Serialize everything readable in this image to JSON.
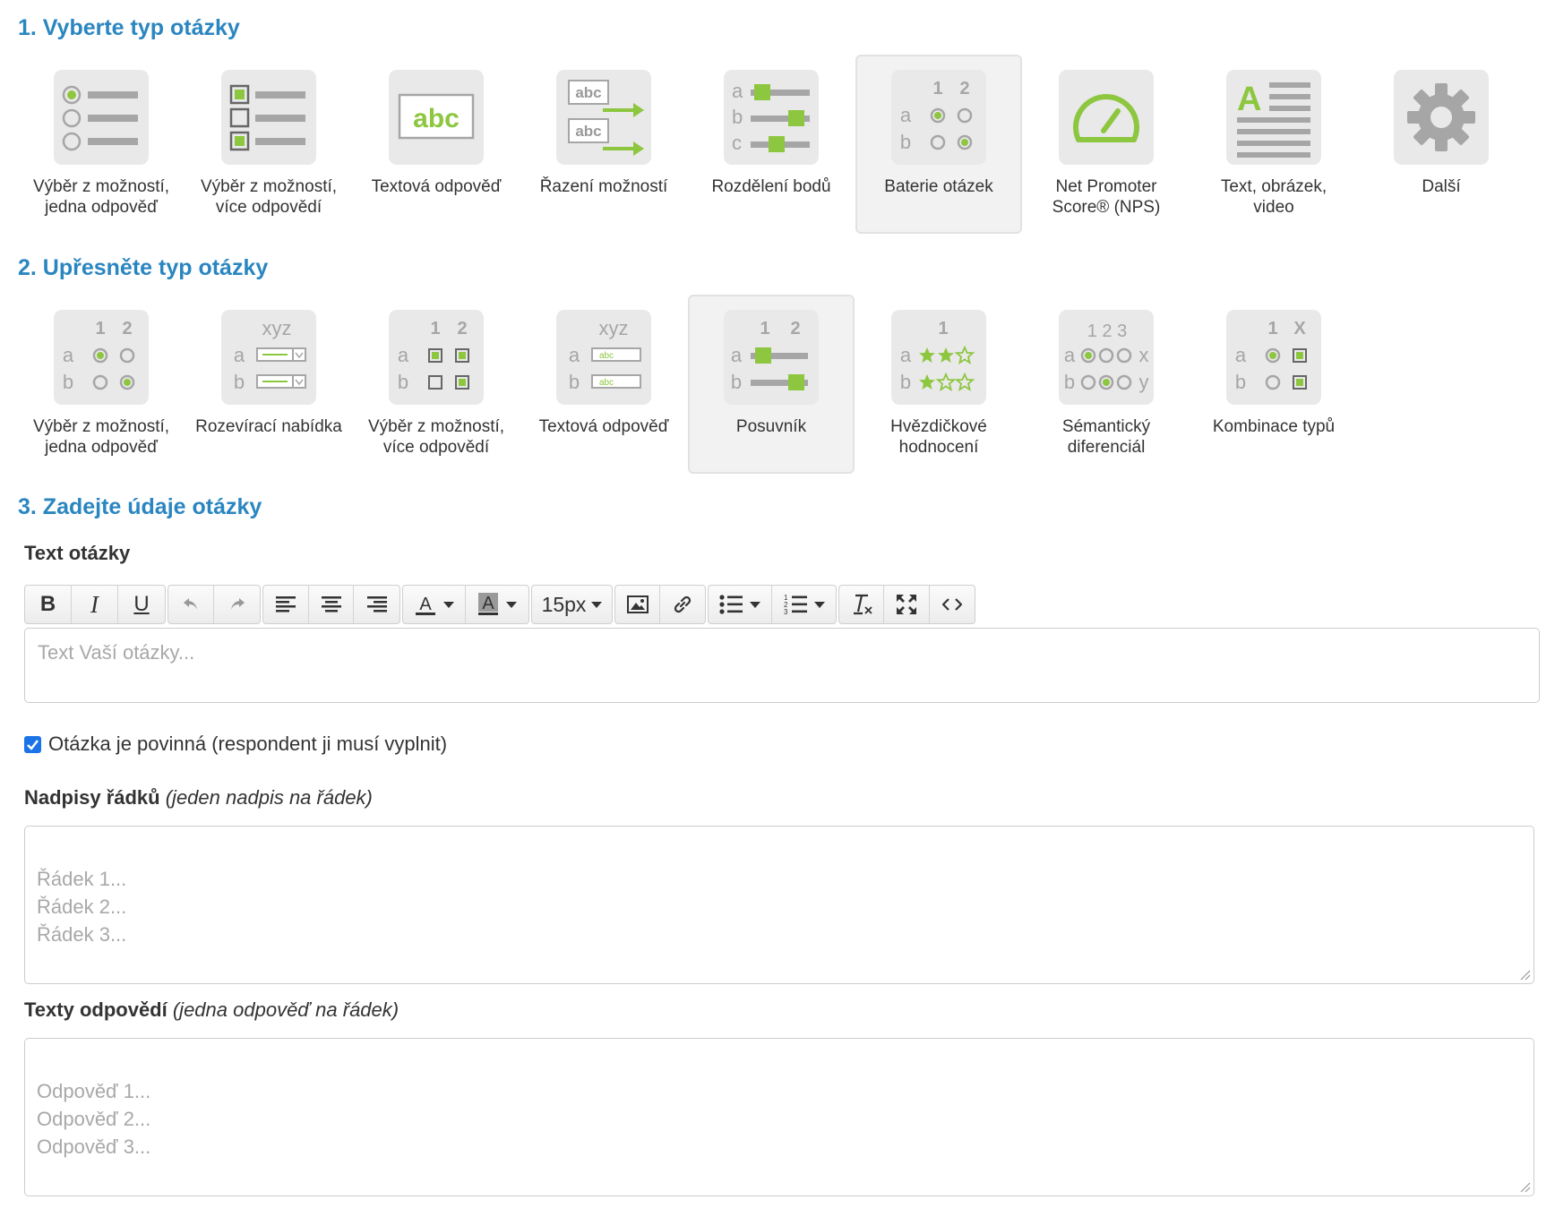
{
  "step1": {
    "title": "1. Vyberte typ otázky",
    "types": [
      {
        "label": "Výběr z možností,\njedna odpověď",
        "icon": "single-choice-icon"
      },
      {
        "label": "Výběr z možností,\nvíce odpovědí",
        "icon": "multiple-choice-icon"
      },
      {
        "label": "Textová odpověď",
        "icon": "text-answer-icon"
      },
      {
        "label": "Řazení možností",
        "icon": "ranking-icon"
      },
      {
        "label": "Rozdělení bodů",
        "icon": "points-allocation-icon"
      },
      {
        "label": "Baterie otázek",
        "icon": "question-battery-icon",
        "selected": true
      },
      {
        "label": "Net Promoter\nScore® (NPS)",
        "icon": "nps-gauge-icon"
      },
      {
        "label": "Text, obrázek,\nvideo",
        "icon": "text-image-video-icon"
      },
      {
        "label": "Další",
        "icon": "gear-icon"
      }
    ]
  },
  "step2": {
    "title": "2. Upřesněte typ otázky",
    "types": [
      {
        "label": "Výběr z možností,\njedna odpověď",
        "icon": "matrix-single-choice-icon"
      },
      {
        "label": "Rozevírací nabídka",
        "icon": "matrix-dropdown-icon"
      },
      {
        "label": "Výběr z možností,\nvíce odpovědí",
        "icon": "matrix-multiple-choice-icon"
      },
      {
        "label": "Textová odpověď",
        "icon": "matrix-text-icon"
      },
      {
        "label": "Posuvník",
        "icon": "matrix-slider-icon",
        "selected": true
      },
      {
        "label": "Hvězdičkové\nhodnocení",
        "icon": "star-rating-icon"
      },
      {
        "label": "Sémantický\ndiferenciál",
        "icon": "semantic-differential-icon"
      },
      {
        "label": "Kombinace typů",
        "icon": "type-combination-icon"
      }
    ]
  },
  "step3": {
    "title": "3. Zadejte údaje otázky",
    "question_text_label": "Text otázky",
    "toolbar": {
      "font_size": "15px",
      "buttons": [
        "bold-icon",
        "italic-icon",
        "underline-icon",
        "undo-icon",
        "redo-icon",
        "align-left-icon",
        "align-center-icon",
        "align-right-icon",
        "font-color-icon",
        "background-color-icon",
        "image-icon",
        "link-icon",
        "bullet-list-icon",
        "numbered-list-icon",
        "clear-format-icon",
        "fullscreen-icon",
        "code-view-icon"
      ]
    },
    "question_placeholder": "Text Vaší otázky...",
    "required_checkbox": {
      "label": "Otázka je povinná (respondent ji musí vyplnit)",
      "checked": true
    },
    "rows_label": "Nadpisy řádků",
    "rows_hint": "(jeden nadpis na řádek)",
    "rows_placeholder": "Řádek 1...\nŘádek 2...\nŘádek 3...",
    "answers_label": "Texty odpovědí",
    "answers_hint": "(jedna odpověď na řádek)",
    "answers_placeholder": "Odpověď 1...\nOdpověď 2...\nOdpověď 3..."
  },
  "colors": {
    "accent": "#2a86c0",
    "green": "#8dc63f",
    "icon_gray": "#a6a6a6"
  },
  "icon_text": {
    "abc": "abc",
    "a": "a",
    "b": "b",
    "c": "c",
    "one": "1",
    "two": "2",
    "three": "3",
    "xyz": "xyz",
    "x": "x",
    "y": "y",
    "big_a": "A",
    "col_x": "X",
    "one_two_three": "1 2 3"
  }
}
